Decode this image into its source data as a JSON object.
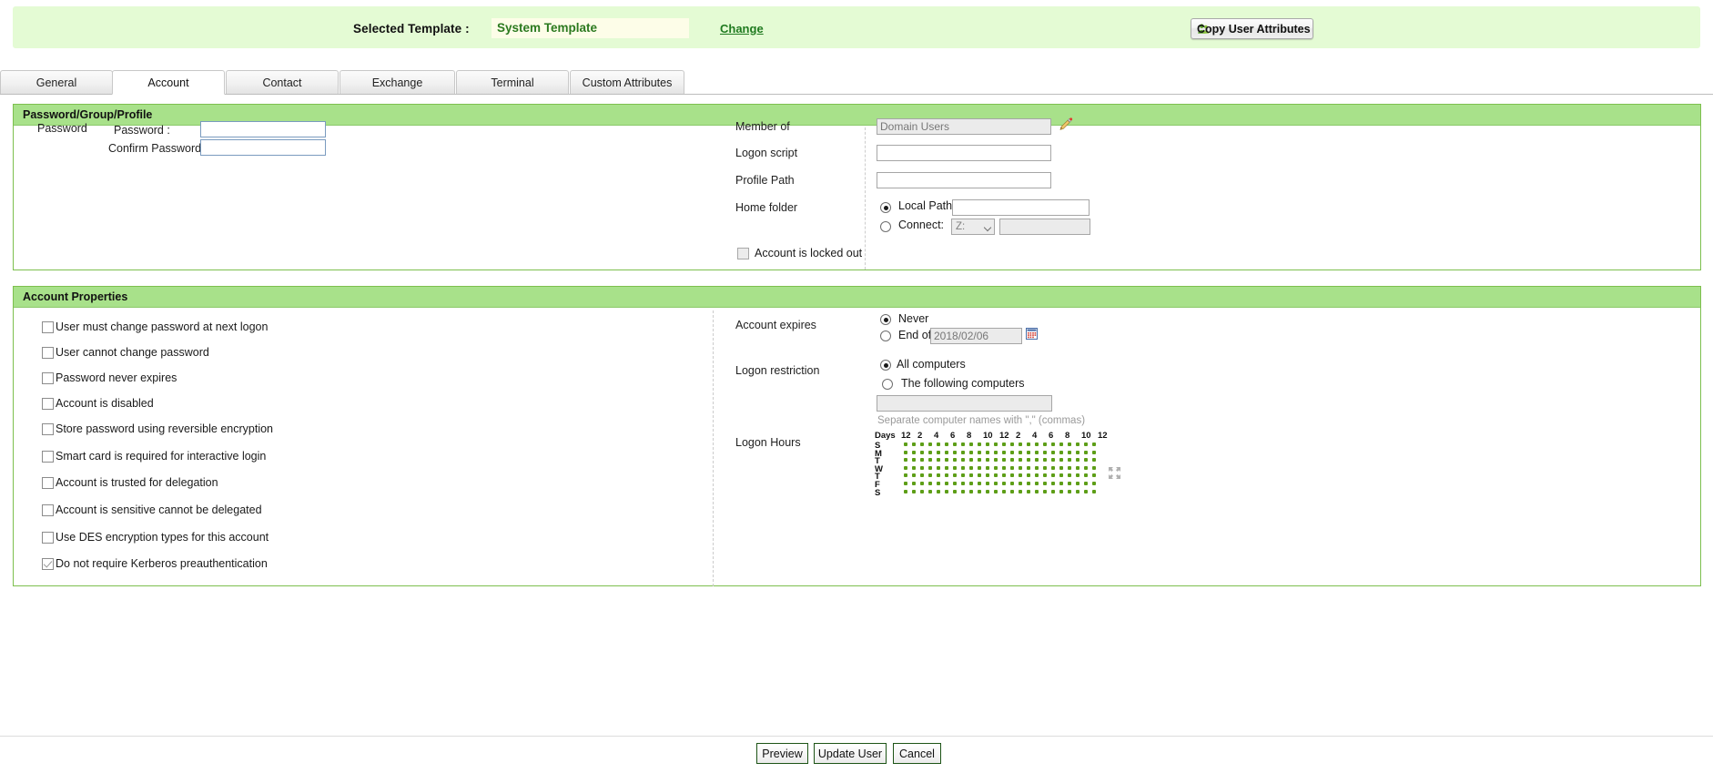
{
  "template_bar": {
    "label": "Selected Template :",
    "value": "System Template",
    "change_link": "Change",
    "copy_button": "Copy User Attributes",
    "copy_button_icon": "user-icon"
  },
  "tabs": [
    {
      "label": "General",
      "active": false
    },
    {
      "label": "Account",
      "active": true
    },
    {
      "label": "Contact",
      "active": false
    },
    {
      "label": "Exchange",
      "active": false
    },
    {
      "label": "Terminal",
      "active": false
    },
    {
      "label": "Custom Attributes",
      "active": false
    }
  ],
  "password_panel": {
    "title": "Password/Group/Profile",
    "group_label": "Password",
    "password_label": "Password :",
    "password_value": "",
    "confirm_label": "Confirm Password :",
    "confirm_value": "",
    "member_of_label": "Member of",
    "member_of_value": "Domain Users",
    "member_of_edit_icon": "pencil-icon",
    "logon_script_label": "Logon script",
    "logon_script_value": "",
    "profile_path_label": "Profile Path",
    "profile_path_value": "",
    "home_folder_label": "Home folder",
    "local_path_label": "Local Path:",
    "local_path_value": "",
    "local_path_selected": true,
    "connect_label": "Connect:",
    "connect_selected": false,
    "connect_drive": "Z:",
    "connect_path_value": "",
    "locked_out_label": "Account is locked out",
    "locked_out_checked": false
  },
  "account_properties": {
    "title": "Account Properties",
    "checkboxes": [
      {
        "label": "User must change password at next logon",
        "checked": false
      },
      {
        "label": "User cannot change password",
        "checked": false
      },
      {
        "label": "Password never expires",
        "checked": false
      },
      {
        "label": "Account is disabled",
        "checked": false
      },
      {
        "label": "Store password using reversible encryption",
        "checked": false
      },
      {
        "label": "Smart card is required for interactive login",
        "checked": false
      },
      {
        "label": "Account is trusted for delegation",
        "checked": false
      },
      {
        "label": "Account is sensitive cannot be delegated",
        "checked": false
      },
      {
        "label": "Use DES encryption types for this account",
        "checked": false
      },
      {
        "label": "Do not require Kerberos preauthentication",
        "checked": true
      }
    ],
    "account_expires_label": "Account expires",
    "never_label": "Never",
    "never_selected": true,
    "end_of_label": "End of",
    "end_of_selected": false,
    "end_of_date": "2018/02/06",
    "calendar_icon": "calendar-icon",
    "logon_restriction_label": "Logon restriction",
    "all_computers_label": "All computers",
    "all_computers_selected": true,
    "following_computers_label": "The following computers",
    "following_computers_selected": false,
    "computers_value": "",
    "computers_hint": "Separate computer names with \",\" (commas)",
    "logon_hours_label": "Logon Hours",
    "logon_hours": {
      "days_header": "Days",
      "hour_labels": [
        "12",
        "2",
        "4",
        "6",
        "8",
        "10",
        "12",
        "2",
        "4",
        "6",
        "8",
        "10",
        "12"
      ],
      "day_labels": [
        "S",
        "M",
        "T",
        "W",
        "T",
        "F",
        "S"
      ],
      "columns": 24,
      "rows": 7,
      "dot_color": "#5d9e17",
      "all_selected": true,
      "expand_icon": "expand-icon"
    }
  },
  "footer": {
    "preview": "Preview",
    "update_user": "Update User",
    "cancel": "Cancel"
  },
  "colors": {
    "bar_green": "#e4fbd4",
    "panel_head_green": "#a8e18a",
    "panel_border_green": "#7dbf4e",
    "link_green": "#1f7a1f",
    "dot_green": "#5d9e17"
  }
}
